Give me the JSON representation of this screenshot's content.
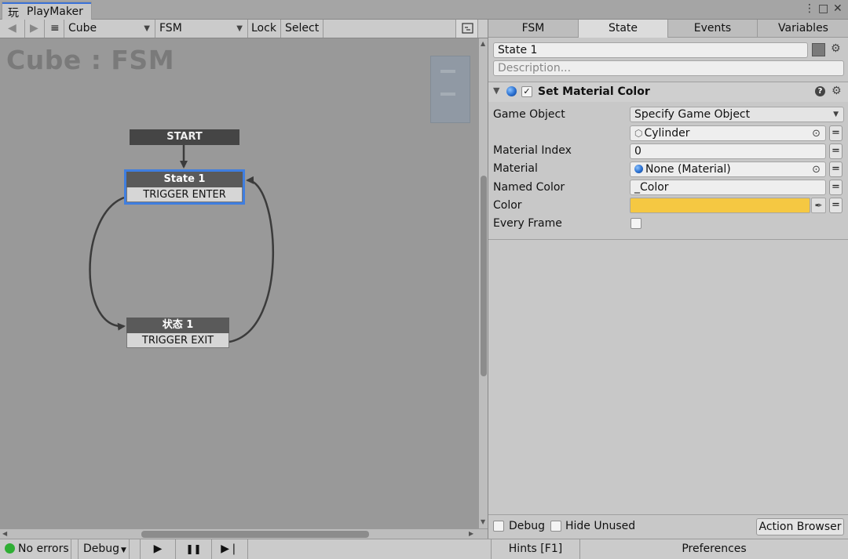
{
  "window": {
    "tab_glyph": "玩",
    "title": "PlayMaker",
    "menu_glyph": "⋮",
    "maximize_glyph": "□",
    "close_glyph": "✕"
  },
  "toolbar": {
    "back_glyph": "◀",
    "forward_glyph": "▶",
    "menu_glyph": "≡",
    "gameobject_select": "Cube",
    "fsm_select": "FSM",
    "lock_label": "Lock",
    "select_label": "Select"
  },
  "graph": {
    "title": "Cube : FSM",
    "start_label": "START",
    "nodes": [
      {
        "name": "State 1",
        "transition": "TRIGGER ENTER",
        "selected": true
      },
      {
        "name": "状态 1",
        "transition": "TRIGGER EXIT",
        "selected": false
      }
    ]
  },
  "statusbar": {
    "errors_label": "No errors",
    "debug_label": "Debug",
    "play_glyph": "▶",
    "pause_glyph": "❚❚",
    "step_glyph": "▶❘",
    "hints_label": "Hints [F1]",
    "preferences_label": "Preferences"
  },
  "inspector": {
    "tabs": [
      "FSM",
      "State",
      "Events",
      "Variables"
    ],
    "active_tab": "State",
    "state_name": "State 1",
    "description_placeholder": "Description...",
    "action": {
      "title": "Set Material Color",
      "enabled": true,
      "help_glyph": "?",
      "gear_glyph": "⚙",
      "fields": {
        "game_object_label": "Game Object",
        "game_object_mode": "Specify Game Object",
        "game_object_value": "Cylinder",
        "material_index_label": "Material Index",
        "material_index_value": "0",
        "material_label": "Material",
        "material_value": "None (Material)",
        "named_color_label": "Named Color",
        "named_color_value": "_Color",
        "color_label": "Color",
        "color_value": "#f5c842",
        "every_frame_label": "Every Frame",
        "every_frame_checked": false
      }
    },
    "footer": {
      "debug_label": "Debug",
      "hide_unused_label": "Hide Unused",
      "action_browser_label": "Action Browser"
    }
  }
}
